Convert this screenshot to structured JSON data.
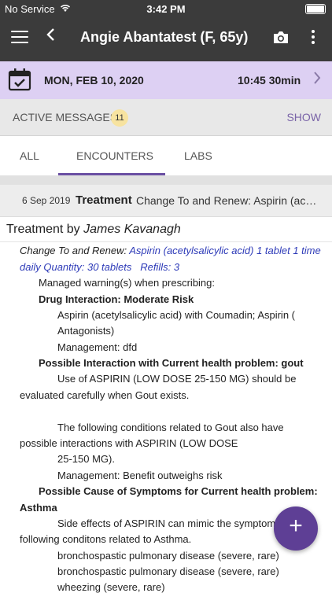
{
  "status_bar": {
    "carrier": "No Service",
    "time": "3:42 PM"
  },
  "header": {
    "title": "Angie Abantatest (F, 65y)"
  },
  "appointment": {
    "date": "MON, FEB 10, 2020",
    "time": "10:45 30min"
  },
  "messages": {
    "label": "ACTIVE MESSAGES",
    "count": "11",
    "show_label": "SHOW"
  },
  "tabs": [
    {
      "label": "ALL"
    },
    {
      "label": "ENCOUNTERS"
    },
    {
      "label": "LABS"
    }
  ],
  "record": {
    "date": "6 Sep 2019",
    "type": "Treatment",
    "summary": "Change To and Renew: Aspirin (acetylsalicylic acid)",
    "detail_title_prefix": "Treatment by",
    "author": "James Kavanagh"
  },
  "detail": {
    "l1a": "Change To and Renew:",
    "l1b": "Aspirin (acetylsalicylic acid) 1 tablet 1 time",
    "l2a": "daily Quantity: 30 tablets",
    "l2b": "Refills: 3",
    "l3": "Managed warning(s) when prescribing:",
    "l4": "Drug Interaction: Moderate Risk",
    "l5": "Aspirin (acetylsalicylic acid) with Coumadin; Aspirin (",
    "l6": "Antagonists)",
    "l7": "Management: dfd",
    "l8": "Possible Interaction with Current health problem: gout",
    "l9": "Use of ASPIRIN (LOW DOSE 25-150 MG) should be",
    "l10": "evaluated carefully when Gout exists.",
    "l11": "The following conditions related to Gout also have",
    "l12": "possible interactions with ASPIRIN (LOW DOSE",
    "l13": "25-150 MG).",
    "l14": "Management: Benefit outweighs risk",
    "l15": "Possible Cause of Symptoms for Current health problem:",
    "l16": "Asthma",
    "l17": "Side effects of ASPIRIN can mimic the symptoms",
    "l18": "following conditons related to Asthma.",
    "l19": "bronchospastic pulmonary disease  (severe, rare)",
    "l20": "bronchospastic pulmonary disease  (severe, rare)",
    "l21": "wheezing  (severe, rare)"
  },
  "fab": {
    "symbol": "+"
  }
}
